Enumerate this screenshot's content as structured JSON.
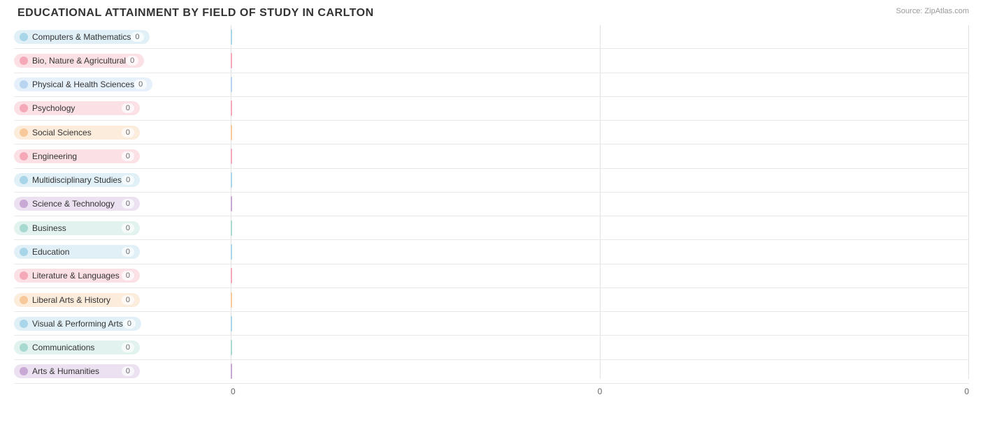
{
  "title": "EDUCATIONAL ATTAINMENT BY FIELD OF STUDY IN CARLTON",
  "source": "Source: ZipAtlas.com",
  "xLabels": [
    "0",
    "0",
    "0"
  ],
  "bars": [
    {
      "label": "Computers & Mathematics",
      "value": "0",
      "dotColor": "#a8d5e8",
      "pillColor": "rgba(168,213,232,0.35)"
    },
    {
      "label": "Bio, Nature & Agricultural",
      "value": "0",
      "dotColor": "#f4a8b8",
      "pillColor": "rgba(244,168,184,0.35)"
    },
    {
      "label": "Physical & Health Sciences",
      "value": "0",
      "dotColor": "#b8d4f0",
      "pillColor": "rgba(184,212,240,0.35)"
    },
    {
      "label": "Psychology",
      "value": "0",
      "dotColor": "#f4a8b8",
      "pillColor": "rgba(244,168,184,0.35)"
    },
    {
      "label": "Social Sciences",
      "value": "0",
      "dotColor": "#f7c89a",
      "pillColor": "rgba(247,200,154,0.35)"
    },
    {
      "label": "Engineering",
      "value": "0",
      "dotColor": "#f4a8b8",
      "pillColor": "rgba(244,168,184,0.35)"
    },
    {
      "label": "Multidisciplinary Studies",
      "value": "0",
      "dotColor": "#a8d5e8",
      "pillColor": "rgba(168,213,232,0.35)"
    },
    {
      "label": "Science & Technology",
      "value": "0",
      "dotColor": "#c8a8d4",
      "pillColor": "rgba(200,168,212,0.35)"
    },
    {
      "label": "Business",
      "value": "0",
      "dotColor": "#a8d9d0",
      "pillColor": "rgba(168,217,208,0.35)"
    },
    {
      "label": "Education",
      "value": "0",
      "dotColor": "#a8d5e8",
      "pillColor": "rgba(168,213,232,0.35)"
    },
    {
      "label": "Literature & Languages",
      "value": "0",
      "dotColor": "#f4a8b8",
      "pillColor": "rgba(244,168,184,0.35)"
    },
    {
      "label": "Liberal Arts & History",
      "value": "0",
      "dotColor": "#f7c89a",
      "pillColor": "rgba(247,200,154,0.35)"
    },
    {
      "label": "Visual & Performing Arts",
      "value": "0",
      "dotColor": "#a8d5e8",
      "pillColor": "rgba(168,213,232,0.35)"
    },
    {
      "label": "Communications",
      "value": "0",
      "dotColor": "#a8d9d0",
      "pillColor": "rgba(168,217,208,0.35)"
    },
    {
      "label": "Arts & Humanities",
      "value": "0",
      "dotColor": "#c8a8d4",
      "pillColor": "rgba(200,168,212,0.35)"
    }
  ]
}
